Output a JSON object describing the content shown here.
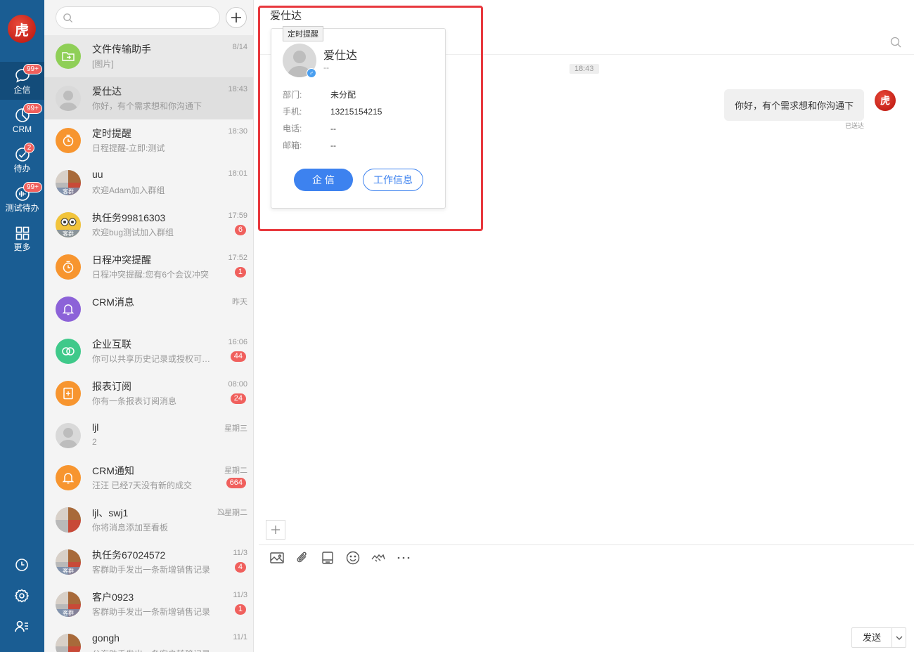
{
  "nav": {
    "logo_text": "虎",
    "items": [
      {
        "label": "企信",
        "badge": "99+",
        "icon": "chat-bubble-icon"
      },
      {
        "label": "CRM",
        "badge": "99+",
        "icon": "pie-chart-icon"
      },
      {
        "label": "待办",
        "badge": "2",
        "icon": "check-circle-icon"
      },
      {
        "label": "测试待办",
        "badge": "99+",
        "icon": "waveform-icon"
      },
      {
        "label": "更多",
        "badge": "",
        "icon": "grid-icon"
      }
    ],
    "tools": [
      "clock-icon",
      "gear-icon",
      "user-list-icon"
    ]
  },
  "search": {
    "placeholder": "",
    "value": ""
  },
  "conversations": [
    {
      "name": "文件传输助手",
      "preview": "[图片]",
      "time": "8/14",
      "badge": "",
      "avatar": "file-transfer"
    },
    {
      "name": "爱仕达",
      "preview": "你好，有个需求想和你沟通下",
      "time": "18:43",
      "badge": "",
      "avatar": "person"
    },
    {
      "name": "定时提醒",
      "preview": "日程提醒-立即:测试",
      "time": "18:30",
      "badge": "",
      "avatar": "timer"
    },
    {
      "name": "uu",
      "preview": "欢迎Adam加入群组",
      "time": "18:01",
      "badge": "",
      "avatar": "group",
      "tag": "客群"
    },
    {
      "name": "执任务99816303",
      "preview": "欢迎bug测试加入群组",
      "time": "17:59",
      "badge": "6",
      "avatar": "group-yellow",
      "tag": "客群"
    },
    {
      "name": "日程冲突提醒",
      "preview": "日程冲突提醒:您有6个会议冲突",
      "time": "17:52",
      "badge": "1",
      "avatar": "timer"
    },
    {
      "name": "CRM消息",
      "preview": "",
      "time": "昨天",
      "badge": "",
      "avatar": "bell-purple"
    },
    {
      "name": "企业互联",
      "preview": "你可以共享历史记录或授权可以查看",
      "time": "16:06",
      "badge": "44",
      "avatar": "link-green"
    },
    {
      "name": "报表订阅",
      "preview": "你有一条报表订阅消息",
      "time": "08:00",
      "badge": "24",
      "avatar": "report"
    },
    {
      "name": "ljl",
      "preview": "2",
      "time": "星期三",
      "badge": "",
      "avatar": "person"
    },
    {
      "name": "CRM通知",
      "preview": "汪汪 已经7天没有新的成交",
      "time": "星期二",
      "badge": "664",
      "avatar": "bell-orange"
    },
    {
      "name": "ljl、swj1",
      "preview": "你将消息添加至看板",
      "time": "星期二",
      "badge": "",
      "avatar": "group",
      "muted": true
    },
    {
      "name": "执任务67024572",
      "preview": "客群助手发出一条新增销售记录",
      "time": "11/3",
      "badge": "4",
      "avatar": "group",
      "tag": "客群"
    },
    {
      "name": "客户0923",
      "preview": "客群助手发出一条新增销售记录",
      "time": "11/3",
      "badge": "1",
      "avatar": "group",
      "tag": "客群"
    },
    {
      "name": "gongh",
      "preview": "公海助手发出一条客户转移记录",
      "time": "11/1",
      "badge": "",
      "avatar": "group"
    }
  ],
  "chat": {
    "title": "爱仕达",
    "timestamp": "18:43",
    "message": "你好，有个需求想和你沟通下",
    "status": "已送达",
    "me_avatar_text": "虎"
  },
  "card": {
    "tooltip": "定时提醒",
    "name": "爱仕达",
    "subtitle": "--",
    "fields": [
      {
        "key": "部门:",
        "value": "未分配"
      },
      {
        "key": "手机:",
        "value": "13215154215"
      },
      {
        "key": "电话:",
        "value": "--"
      },
      {
        "key": "邮箱:",
        "value": "--"
      }
    ],
    "primary_button": "企 信",
    "secondary_button": "工作信息"
  },
  "composer": {
    "send_label": "发送",
    "tools": [
      "image-icon",
      "paperclip-icon",
      "folder-icon",
      "smiley-icon",
      "handshake-icon",
      "more-icon"
    ]
  },
  "colors": {
    "nav_bg": "#1a5d93",
    "accent": "#3d82ef",
    "badge": "#f0605d",
    "highlight_frame": "#e8383d"
  }
}
